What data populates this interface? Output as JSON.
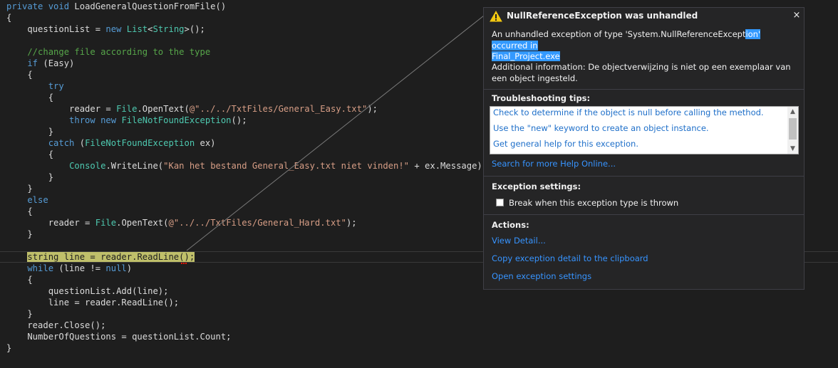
{
  "code": {
    "lines": [
      [
        {
          "t": "private void ",
          "c": "kw"
        },
        {
          "t": "LoadGeneralQuestionFromFile()",
          "c": "pl"
        }
      ],
      [
        {
          "t": "{",
          "c": "pl"
        }
      ],
      [
        {
          "t": "    questionList = ",
          "c": "pl"
        },
        {
          "t": "new ",
          "c": "kw"
        },
        {
          "t": "List",
          "c": "ty"
        },
        {
          "t": "<",
          "c": "pl"
        },
        {
          "t": "String",
          "c": "ty"
        },
        {
          "t": ">();",
          "c": "pl"
        }
      ],
      [],
      [
        {
          "t": "    //change file according to the type",
          "c": "cm"
        }
      ],
      [
        {
          "t": "    if ",
          "c": "kw"
        },
        {
          "t": "(Easy)",
          "c": "pl"
        }
      ],
      [
        {
          "t": "    {",
          "c": "pl"
        }
      ],
      [
        {
          "t": "        try",
          "c": "kw"
        }
      ],
      [
        {
          "t": "        {",
          "c": "pl"
        }
      ],
      [
        {
          "t": "            reader = ",
          "c": "pl"
        },
        {
          "t": "File",
          "c": "ty"
        },
        {
          "t": ".OpenText(",
          "c": "pl"
        },
        {
          "t": "@\"../../TxtFiles/General_Easy.txt\"",
          "c": "st"
        },
        {
          "t": ");",
          "c": "pl"
        }
      ],
      [
        {
          "t": "            throw new ",
          "c": "kw"
        },
        {
          "t": "FileNotFoundException",
          "c": "ty"
        },
        {
          "t": "();",
          "c": "pl"
        }
      ],
      [
        {
          "t": "        }",
          "c": "pl"
        }
      ],
      [
        {
          "t": "        catch ",
          "c": "kw"
        },
        {
          "t": "(",
          "c": "pl"
        },
        {
          "t": "FileNotFoundException",
          "c": "ty"
        },
        {
          "t": " ex)",
          "c": "pl"
        }
      ],
      [
        {
          "t": "        {",
          "c": "pl"
        }
      ],
      [
        {
          "t": "            ",
          "c": "pl"
        },
        {
          "t": "Console",
          "c": "ty"
        },
        {
          "t": ".WriteLine(",
          "c": "pl"
        },
        {
          "t": "\"Kan het bestand General_Easy.txt niet vinden!\"",
          "c": "st"
        },
        {
          "t": " + ex.Message);",
          "c": "pl"
        }
      ],
      [
        {
          "t": "        }",
          "c": "pl"
        }
      ],
      [
        {
          "t": "    }",
          "c": "pl"
        }
      ],
      [
        {
          "t": "    else",
          "c": "kw"
        }
      ],
      [
        {
          "t": "    {",
          "c": "pl"
        }
      ],
      [
        {
          "t": "        reader = ",
          "c": "pl"
        },
        {
          "t": "File",
          "c": "ty"
        },
        {
          "t": ".OpenText(",
          "c": "pl"
        },
        {
          "t": "@\"../../TxtFiles/General_Hard.txt\"",
          "c": "st"
        },
        {
          "t": ");",
          "c": "pl"
        }
      ],
      [
        {
          "t": "    }",
          "c": "pl"
        }
      ],
      [],
      [
        {
          "t": "    ",
          "c": "pl"
        },
        {
          "t": "string line = reader.ReadLine();",
          "c": "hl"
        }
      ],
      [
        {
          "t": "    while ",
          "c": "kw"
        },
        {
          "t": "(line != ",
          "c": "pl"
        },
        {
          "t": "null",
          "c": "kw"
        },
        {
          "t": ")",
          "c": "pl"
        }
      ],
      [
        {
          "t": "    {",
          "c": "pl"
        }
      ],
      [
        {
          "t": "        questionList.Add(line);",
          "c": "pl"
        }
      ],
      [
        {
          "t": "        line = reader.ReadLine();",
          "c": "pl"
        }
      ],
      [
        {
          "t": "    }",
          "c": "pl"
        }
      ],
      [
        {
          "t": "    reader.Close();",
          "c": "pl"
        }
      ],
      [
        {
          "t": "    NumberOfQuestions = questionList.Count;",
          "c": "pl"
        }
      ],
      [
        {
          "t": "}",
          "c": "pl"
        }
      ]
    ]
  },
  "popup": {
    "title": "NullReferenceException was unhandled",
    "close_glyph": "×",
    "message_before": "An unhandled exception of type 'System.NullReferenceExcept",
    "message_selected_1": "ion' occurred in",
    "message_selected_2": "Final_Project.exe",
    "additional": "Additional information: De objectverwijzing is niet op een exemplaar van een object ingesteld.",
    "tips_title": "Troubleshooting tips:",
    "tips": [
      "Check to determine if the object is null before calling the method.",
      "Use the \"new\" keyword to create an object instance.",
      "Get general help for this exception."
    ],
    "search_link": "Search for more Help Online...",
    "settings_title": "Exception settings:",
    "break_label": "Break when this exception type is thrown",
    "break_checked": false,
    "actions_title": "Actions:",
    "actions": [
      "View Detail...",
      "Copy exception detail to the clipboard",
      "Open exception settings"
    ]
  },
  "colors": {
    "editor_bg": "#1e1e1e",
    "keyword": "#569cd6",
    "type": "#4ec9b0",
    "string": "#d69d85",
    "comment": "#57a64a",
    "link": "#3794ff",
    "highlight": "#bfbf6a",
    "warning": "#f2c811"
  },
  "icons": {
    "warning": "warning-triangle-icon",
    "close": "close-icon",
    "scroll_up": "chevron-up-icon",
    "scroll_down": "chevron-down-icon"
  }
}
